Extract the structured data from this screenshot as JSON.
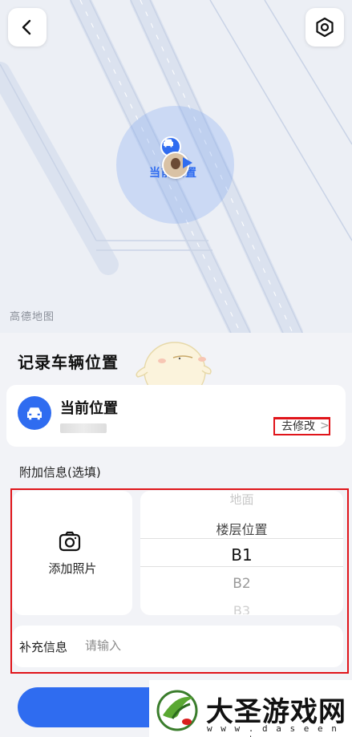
{
  "map": {
    "watermark": "高德地图",
    "location_label": "当前位置"
  },
  "panel": {
    "title": "记录车辆位置"
  },
  "location_card": {
    "title": "当前位置",
    "modify_label": "去修改",
    "chevron": ">"
  },
  "additional": {
    "section_label": "附加信息(选填)",
    "photo_label": "添加照片",
    "floor_picker": {
      "options": [
        "地面",
        "楼层位置",
        "B1",
        "B2",
        "B3"
      ],
      "selected": "B1"
    },
    "extra_label": "补充信息",
    "extra_placeholder": "请输入"
  },
  "brand": {
    "name": "大圣游戏网",
    "url": "w w w . d a s e e n . n e t"
  },
  "colors": {
    "accent": "#2f6cf0",
    "highlight_box": "#e0141a"
  },
  "icons": {
    "back": "chevron-left-icon",
    "settings": "hexagon-gear-icon",
    "camera": "camera-icon",
    "car": "car-icon"
  }
}
